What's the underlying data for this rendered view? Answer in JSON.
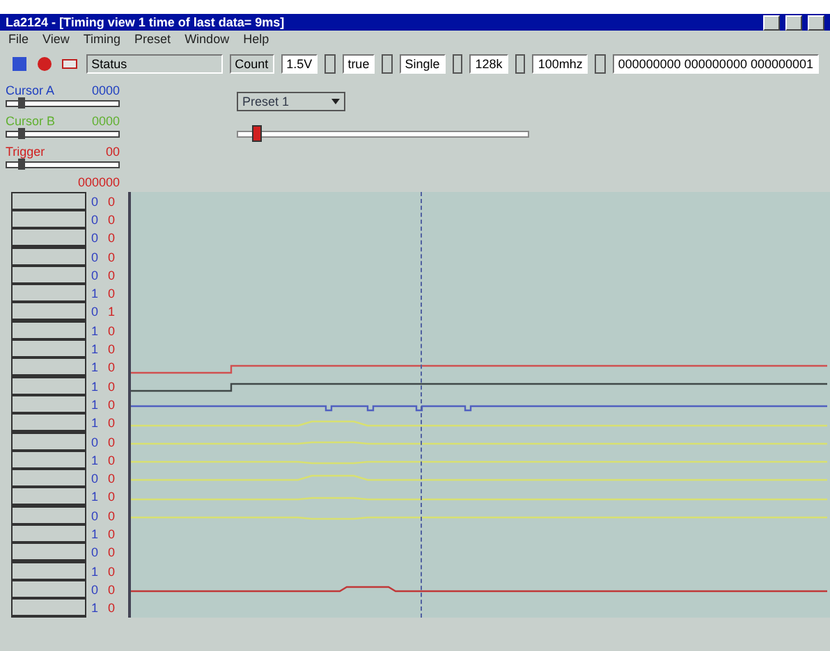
{
  "window": {
    "title": "La2124 - [Timing view 1    time of last data= 9ms]"
  },
  "menu": [
    "File",
    "View",
    "Timing",
    "Preset",
    "Window",
    "Help"
  ],
  "toolbar": {
    "status": "Status",
    "count_label": "Count",
    "fields": [
      "1.5V",
      "true",
      "Single",
      "128k",
      "100mhz"
    ],
    "pattern": "000000000 000000000 000000001"
  },
  "cursors": [
    {
      "label": "Cursor A",
      "value": "0000",
      "color": "#2040c0",
      "level": 0.1
    },
    {
      "label": "Cursor B",
      "value": "0000",
      "color": "#60b030",
      "level": 0.1
    },
    {
      "label": "Trigger",
      "value": "00",
      "color": "#d02020",
      "level": 0.1
    }
  ],
  "preset": {
    "value": "Preset 1"
  },
  "zoom_slider": {
    "level": 0.05
  },
  "value_header": "000000",
  "channels": [
    {
      "value": "0",
      "trig": "0"
    },
    {
      "value": "0",
      "trig": "0"
    },
    {
      "value": "0",
      "trig": "0"
    },
    {
      "value": "0",
      "trig": "0"
    },
    {
      "value": "0",
      "trig": "0"
    },
    {
      "value": "1",
      "trig": "0"
    },
    {
      "value": "0",
      "trig": "1"
    },
    {
      "value": "1",
      "trig": "0"
    },
    {
      "value": "1",
      "trig": "0"
    },
    {
      "value": "1",
      "trig": "0",
      "color": "#d05050"
    },
    {
      "value": "1",
      "trig": "0",
      "color": "#404848"
    },
    {
      "value": "1",
      "trig": "0",
      "color": "#5060c0"
    },
    {
      "value": "1",
      "trig": "0",
      "color": "#d8e070"
    },
    {
      "value": "0",
      "trig": "0",
      "color": "#d8e070"
    },
    {
      "value": "1",
      "trig": "0",
      "color": "#d8e070"
    },
    {
      "value": "0",
      "trig": "0",
      "color": "#d8e070"
    },
    {
      "value": "1",
      "trig": "0",
      "color": "#d8e070"
    },
    {
      "value": "0",
      "trig": "0",
      "color": "#d8e070"
    },
    {
      "value": "1",
      "trig": "0"
    },
    {
      "value": "0",
      "trig": "0"
    },
    {
      "value": "1",
      "trig": "0"
    },
    {
      "value": "0",
      "trig": "0",
      "color": "#c03838"
    },
    {
      "value": "1",
      "trig": "0"
    }
  ]
}
